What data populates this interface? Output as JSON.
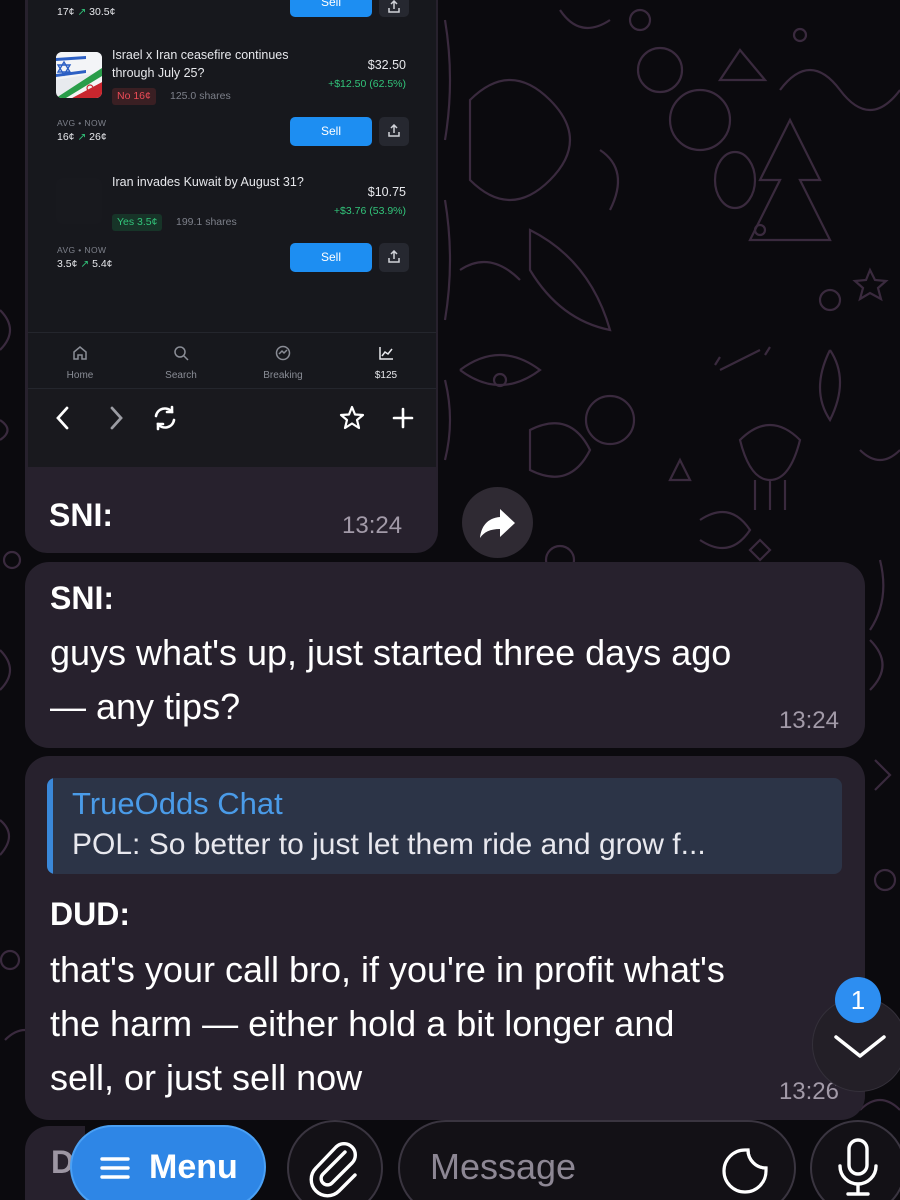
{
  "screenshot": {
    "top_partial": {
      "avg_prices": "17¢ ↗ 30.5¢",
      "sell_label": "Sell"
    },
    "positions": [
      {
        "title": "Israel x Iran ceasefire continues through July 25?",
        "value": "$32.50",
        "gain": "+$12.50 (62.5%)",
        "outcome": "No 16¢",
        "shares": "125.0 shares",
        "avg_label": "AVG • NOW",
        "avg_prices": "16¢ ↗ 26¢",
        "sell_label": "Sell"
      },
      {
        "title": "Iran invades Kuwait by August 31?",
        "value": "$10.75",
        "gain": "+$3.76 (53.9%)",
        "outcome": "Yes 3.5¢",
        "shares": "199.1 shares",
        "avg_label": "AVG • NOW",
        "avg_prices": "3.5¢ ↗ 5.4¢",
        "sell_label": "Sell"
      }
    ],
    "nav": [
      {
        "label": "Home",
        "icon": "home-icon"
      },
      {
        "label": "Search",
        "icon": "search-icon"
      },
      {
        "label": "Breaking",
        "icon": "breaking-icon"
      },
      {
        "label": "$125",
        "icon": "portfolio-chart-icon"
      }
    ],
    "caption_sender": "SNI:",
    "caption_time": "13:24"
  },
  "messages": [
    {
      "sender": "SNI:",
      "text_line1": "guys what's up, just started three days ago",
      "text_line2": "— any tips?",
      "time": "13:24"
    },
    {
      "reply_title": "TrueOdds Chat",
      "reply_text": "POL: So better to just let them ride and grow f...",
      "sender": "DUD:",
      "text_line1": "that's your call bro, if you're in profit what's",
      "text_line2": "the harm — either hold a bit longer and",
      "text_line3": "sell, or just sell now",
      "time": "13:26"
    }
  ],
  "unread_count": "1",
  "composer": {
    "stub_char": "D",
    "menu_label": "Menu",
    "placeholder": "Message"
  },
  "colors": {
    "bubble": "#27212d",
    "accent_blue": "#2e86e6",
    "gain_green": "#32c47a",
    "no_red": "#ec4b57",
    "reply_title": "#4a9be8"
  }
}
